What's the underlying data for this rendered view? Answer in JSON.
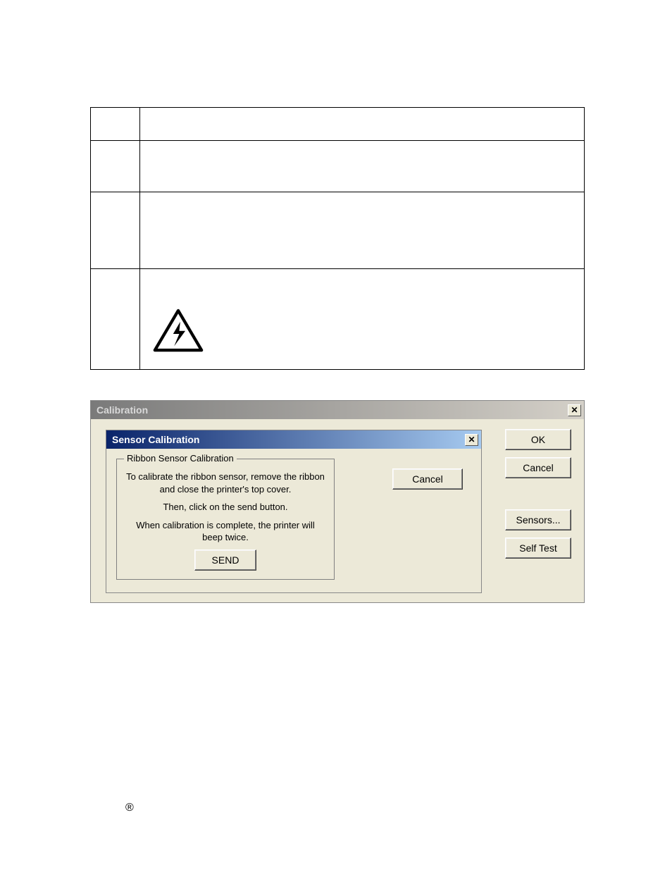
{
  "table": {
    "rows": [
      {
        "step": "",
        "proc": ""
      },
      {
        "step": "",
        "proc": ""
      },
      {
        "step": "",
        "proc": ""
      },
      {
        "step": "",
        "proc": "",
        "has_warning_icon": true
      }
    ]
  },
  "calibration_window": {
    "title": "Calibration",
    "buttons": {
      "ok": "OK",
      "cancel": "Cancel",
      "sensors": "Sensors...",
      "self_test": "Self Test"
    }
  },
  "sensor_window": {
    "title": "Sensor Calibration",
    "group_label": "Ribbon Sensor Calibration",
    "line1": "To calibrate the ribbon sensor, remove the ribbon and close the printer's top cover.",
    "line2": "Then, click on the send button.",
    "line3": "When calibration is complete, the printer will beep twice.",
    "send_label": "SEND",
    "cancel_label": "Cancel"
  },
  "close_glyph": "✕",
  "registered_mark": "®"
}
